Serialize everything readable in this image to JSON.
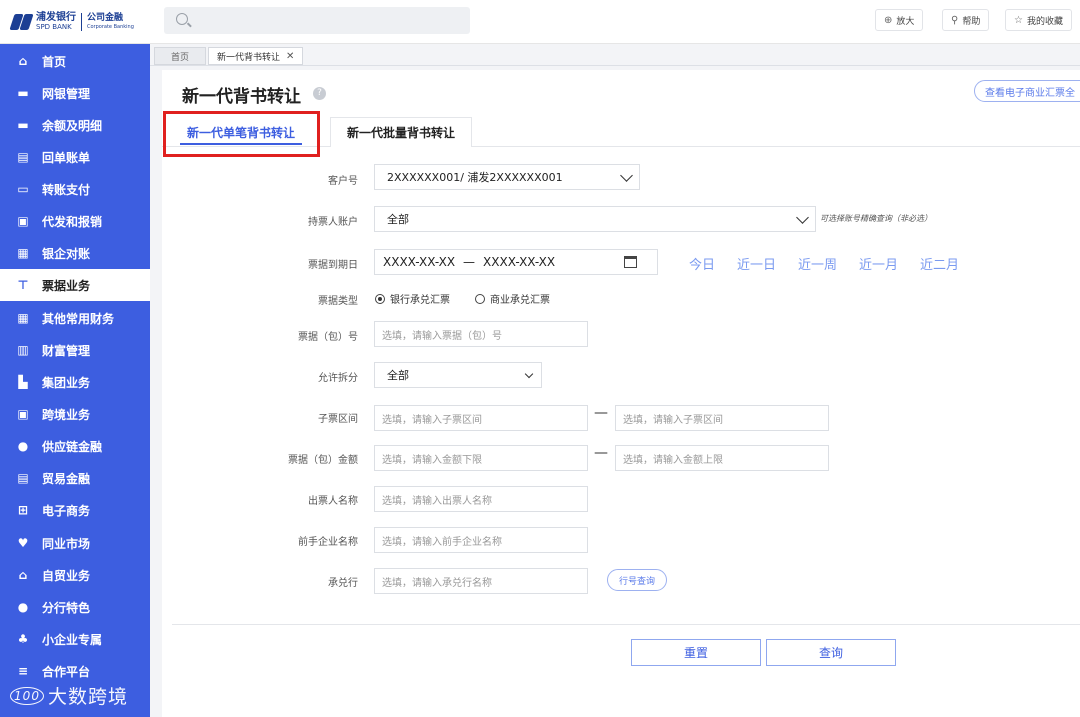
{
  "header": {
    "logo": {
      "cn": "浦发银行",
      "en": "SPD BANK",
      "sub_cn": "公司金融",
      "sub_en": "Corporate Banking"
    },
    "search": {
      "icon": "search-icon"
    },
    "buttons": {
      "zoom": "放大",
      "help": "帮助",
      "favorites": "我的收藏"
    }
  },
  "sidebar": {
    "items": [
      {
        "label": "首页",
        "icon": "home-icon"
      },
      {
        "label": "网银管理",
        "icon": "monitor-icon"
      },
      {
        "label": "余额及明细",
        "icon": "monitor-icon"
      },
      {
        "label": "回单账单",
        "icon": "document-icon"
      },
      {
        "label": "转账支付",
        "icon": "card-icon"
      },
      {
        "label": "代发和报销",
        "icon": "briefcase-icon"
      },
      {
        "label": "银企对账",
        "icon": "ledger-icon"
      },
      {
        "label": "票据业务",
        "icon": "cart-icon",
        "active": true
      },
      {
        "label": "其他常用财务",
        "icon": "grid-icon"
      },
      {
        "label": "财富管理",
        "icon": "chart-icon"
      },
      {
        "label": "集团业务",
        "icon": "building-icon"
      },
      {
        "label": "跨境业务",
        "icon": "suitcase-icon"
      },
      {
        "label": "供应链金融",
        "icon": "cloud-icon"
      },
      {
        "label": "贸易金融",
        "icon": "trade-icon"
      },
      {
        "label": "电子商务",
        "icon": "cart-icon"
      },
      {
        "label": "同业市场",
        "icon": "heart-icon"
      },
      {
        "label": "自贸业务",
        "icon": "bank-icon"
      },
      {
        "label": "分行特色",
        "icon": "pin-icon"
      },
      {
        "label": "小企业专属",
        "icon": "people-icon"
      },
      {
        "label": "合作平台",
        "icon": "layers-icon"
      }
    ],
    "watermark": "大数跨境",
    "watermark_logo": "100"
  },
  "breadcrumb": {
    "home": "首页",
    "current": "新一代背书转让",
    "close": "✕"
  },
  "page": {
    "title": "新一代背书转让",
    "help": "?",
    "view_link": "查看电子商业汇票全",
    "tabs": [
      "新一代单笔背书转让",
      "新一代批量背书转让"
    ]
  },
  "form": {
    "customer_no": {
      "label": "客户号",
      "value": "2XXXXXX001/ 浦发2XXXXXX001"
    },
    "holder_account": {
      "label": "持票人账户",
      "value": "全部",
      "hint": "可选择账号精确查询（非必选）"
    },
    "due_date": {
      "label": "票据到期日",
      "start": "XXXX-XX-XX",
      "sep": "—",
      "end": "XXXX-XX-XX",
      "quick": [
        "今日",
        "近一日",
        "近一周",
        "近一月",
        "近二月"
      ]
    },
    "bill_type": {
      "label": "票据类型",
      "options": [
        "银行承兑汇票",
        "商业承兑汇票"
      ],
      "selected": 0
    },
    "bill_no": {
      "label": "票据（包）号",
      "placeholder": "选填，请输入票据（包）号"
    },
    "allow_split": {
      "label": "允许拆分",
      "value": "全部"
    },
    "sub_range": {
      "label": "子票区间",
      "placeholder_from": "选填，请输入子票区间",
      "sep": "—",
      "placeholder_to": "选填，请输入子票区间"
    },
    "amount": {
      "label": "票据（包）金额",
      "placeholder_min": "选填，请输入金额下限",
      "sep": "—",
      "placeholder_max": "选填，请输入金额上限"
    },
    "drawer": {
      "label": "出票人名称",
      "placeholder": "选填，请输入出票人名称"
    },
    "prev_holder": {
      "label": "前手企业名称",
      "placeholder": "选填，请输入前手企业名称"
    },
    "acceptor": {
      "label": "承兑行",
      "placeholder": "选填，请输入承兑行名称",
      "lookup": "行号查询"
    }
  },
  "actions": {
    "reset": "重置",
    "query": "查询"
  },
  "colors": {
    "sidebar": "#3d5ee0",
    "accent": "#3d5ee0",
    "highlight": "#e0201f"
  }
}
